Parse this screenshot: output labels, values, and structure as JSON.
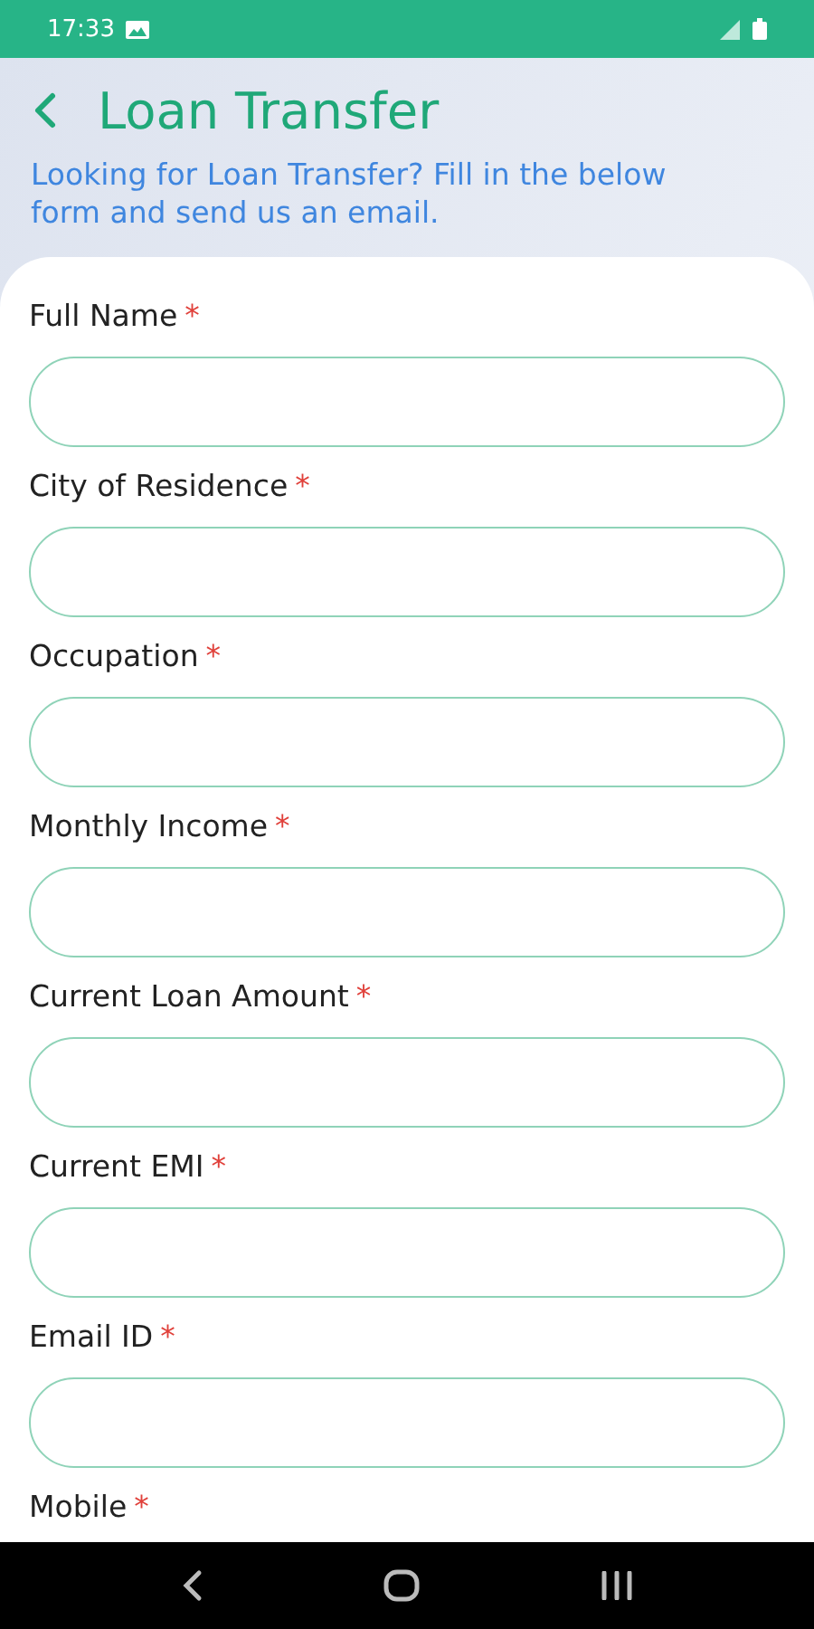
{
  "status_bar": {
    "time": "17:33"
  },
  "header": {
    "title": "Loan Transfer",
    "subtitle": "Looking for Loan Transfer? Fill in the below form and send us an email."
  },
  "form": {
    "fields": [
      {
        "label": "Full Name",
        "required_mark": "*"
      },
      {
        "label": "City of Residence",
        "required_mark": "*"
      },
      {
        "label": "Occupation",
        "required_mark": "*"
      },
      {
        "label": "Monthly Income",
        "required_mark": "*"
      },
      {
        "label": "Current Loan Amount ",
        "required_mark": "*"
      },
      {
        "label": "Current EMI",
        "required_mark": "*"
      },
      {
        "label": "Email ID ",
        "required_mark": "*"
      }
    ],
    "last_label": {
      "label": "Mobile",
      "required_mark": "*"
    }
  }
}
